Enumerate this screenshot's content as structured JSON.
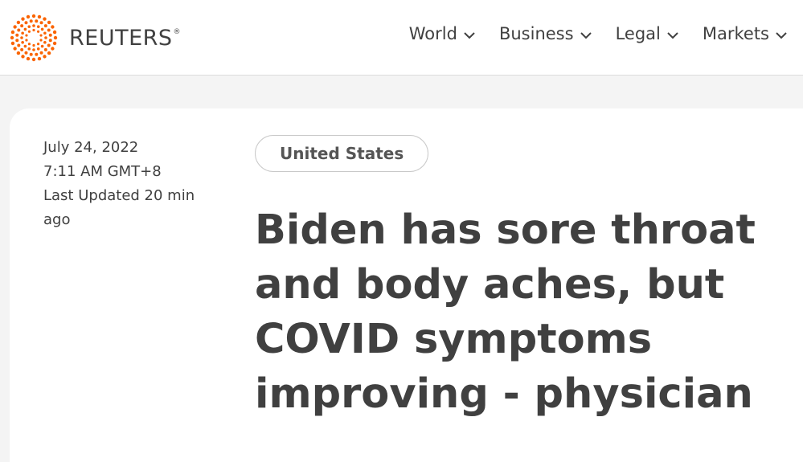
{
  "header": {
    "logo_text": "REUTERS",
    "logo_mark": "®",
    "logo_color": "#fa6400",
    "nav": [
      {
        "label": "World",
        "icon": "chevron-down-icon"
      },
      {
        "label": "Business",
        "icon": "chevron-down-icon"
      },
      {
        "label": "Legal",
        "icon": "chevron-down-icon"
      },
      {
        "label": "Markets",
        "icon": "chevron-down-icon"
      }
    ]
  },
  "article": {
    "date": "July 24, 2022",
    "time": "7:11 AM GMT+8",
    "updated": "Last Updated 20 min ago",
    "category": "United States",
    "headline": "Biden has sore throat and body aches, but COVID symptoms improving - physician"
  }
}
